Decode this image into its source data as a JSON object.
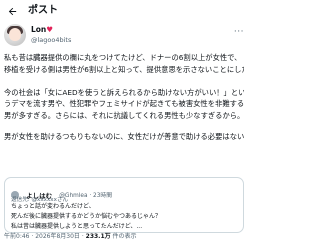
{
  "header": {
    "title": "ポスト"
  },
  "author": {
    "display_name_prefix": "Lon",
    "display_name_heart": "♥",
    "handle": "@lagoo4bits"
  },
  "post": {
    "lines": [
      "私も昔は臓器提供の欄に丸をつけてたけど、ドナーの6割以上が女性で、",
      "移植を受ける側は男性が6割以上と知って、提供意思を示さないことにした。",
      "",
      "今の社会は「女にAEDを使うと訴えられるから助けない方がいい！」とい",
      "うデマを流す男や、性犯罪やフェミサイドが起きても被害女性を非難する",
      "男が多すぎる。さらには、それに抗議してくれる男性も少なすぎるから。",
      "",
      "男が女性を助けるつもりもないのに、女性だけが善意で助ける必要はない"
    ]
  },
  "quote": {
    "name": "よしはむ",
    "handle": "@Ghmlea · 23時間",
    "reply_to": "返信先: @xxxxxxさん",
    "lines": [
      "ちょっと話が変わるんだけど、",
      "死んだ後に臓器提供するかどうか悩むやつあるじゃん？",
      "私は昔は臓器提供しようと思ってたんだけど、..."
    ]
  },
  "footer": {
    "time": "午前0:46 · 2026年8月30日 · ",
    "views": "233.1万",
    "views_suffix": " 件の表示"
  }
}
